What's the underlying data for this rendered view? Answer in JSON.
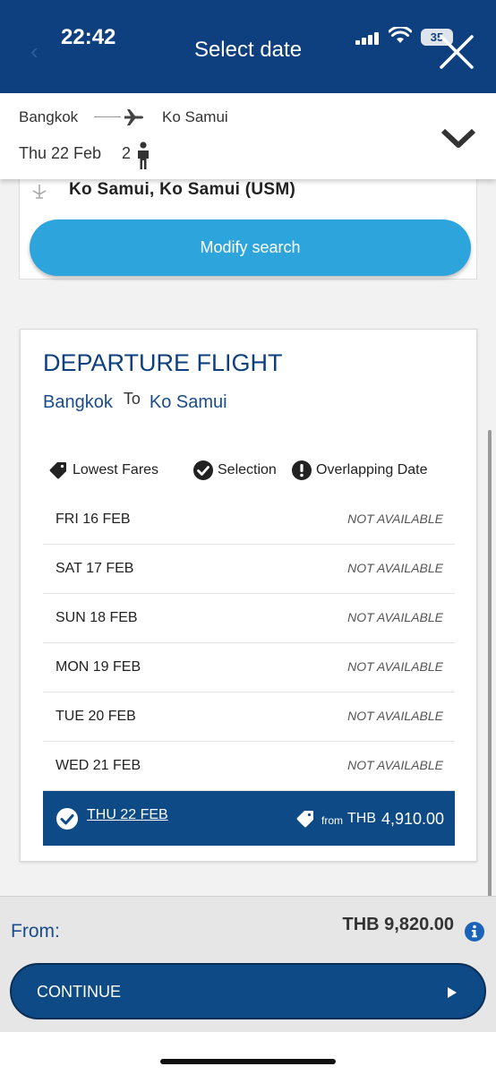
{
  "status_bar": {
    "time": "22:42",
    "battery": "35"
  },
  "header": {
    "title": "Select date"
  },
  "trip": {
    "origin": "Bangkok",
    "destination": "Ko Samui",
    "date": "Thu 22 Feb",
    "passengers": "2"
  },
  "search": {
    "airport": "Ko Samui, Ko Samui (USM)",
    "modify_label": "Modify search"
  },
  "departure": {
    "title": "DEPARTURE FLIGHT",
    "from_city": "Bangkok",
    "to_word": "To",
    "to_city": "Ko Samui",
    "legend": {
      "lowest": "Lowest Fares",
      "selection": "Selection",
      "overlap": "Overlapping Date"
    },
    "dates": [
      {
        "day": "FRI 16 FEB",
        "status": "NOT AVAILABLE"
      },
      {
        "day": "SAT 17 FEB",
        "status": "NOT AVAILABLE"
      },
      {
        "day": "SUN 18 FEB",
        "status": "NOT AVAILABLE"
      },
      {
        "day": "MON 19 FEB",
        "status": "NOT AVAILABLE"
      },
      {
        "day": "TUE 20 FEB",
        "status": "NOT AVAILABLE"
      },
      {
        "day": "WED 21 FEB",
        "status": "NOT AVAILABLE"
      }
    ],
    "selected": {
      "day": "THU 22 FEB",
      "from_label": "from",
      "currency": "THB",
      "price": "4,910.00"
    }
  },
  "footer": {
    "from_label": "From:",
    "total": "THB 9,820.00",
    "continue_label": "CONTINUE"
  },
  "colors": {
    "brand_dark": "#0e3f7e",
    "accent": "#2ea4dd",
    "selected_row": "#0e4a86"
  }
}
